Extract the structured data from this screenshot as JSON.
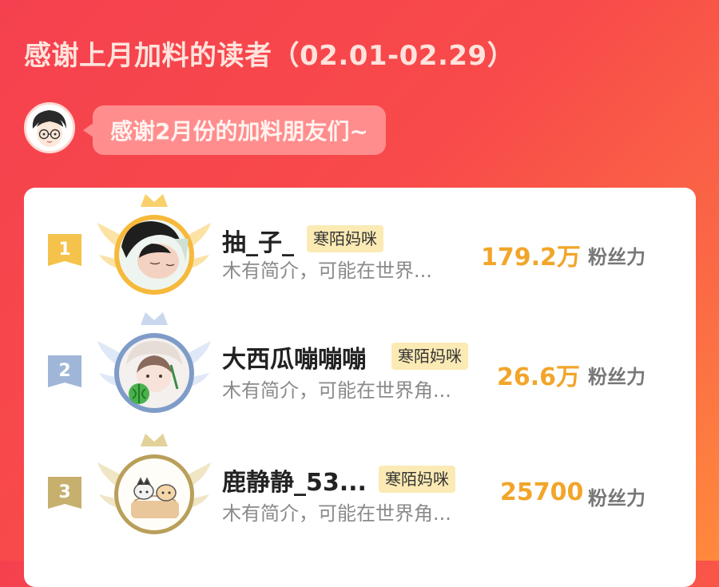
{
  "header": {
    "title": "感谢上月加料的读者（02.01-02.29）"
  },
  "greeting": {
    "message": "感谢2月份的加料朋友们~",
    "avatar_icon": "cartoon-boy-avatar-icon"
  },
  "ranking": [
    {
      "rank": "1",
      "name": "抽_子_",
      "tag": "寒陌妈咪",
      "bio": "木有简介，可能在世界...",
      "score": "179.2万",
      "score_unit": "粉丝力",
      "badge_color": "#f5c24c",
      "ring_color": "#f6b93b",
      "wing_color": "#fbe3a6"
    },
    {
      "rank": "2",
      "name": "大西瓜嘣嘣嘣",
      "tag": "寒陌妈咪",
      "bio": "木有简介，可能在世界角...",
      "score": "26.6万",
      "score_unit": "粉丝力",
      "badge_color": "#9fb6d8",
      "ring_color": "#7f9cc8",
      "wing_color": "#dfe8f6"
    },
    {
      "rank": "3",
      "name": "鹿静静_53...",
      "tag": "寒陌妈咪",
      "bio": "木有简介，可能在世界角...",
      "score": "25700",
      "score_unit": "粉丝力",
      "badge_color": "#c7b06e",
      "ring_color": "#b99f5a",
      "wing_color": "#f0e6c6"
    }
  ]
}
